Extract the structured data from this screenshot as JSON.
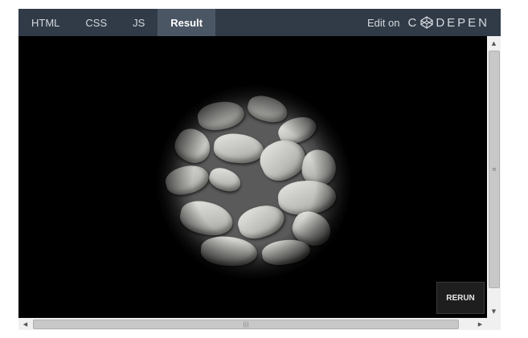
{
  "tabs": [
    {
      "label": "HTML",
      "active": false
    },
    {
      "label": "CSS",
      "active": false
    },
    {
      "label": "JS",
      "active": false
    },
    {
      "label": "Result",
      "active": true
    }
  ],
  "edit_on": {
    "label": "Edit on",
    "brand": "CODEPEN"
  },
  "result": {
    "rerun_label": "RERUN"
  },
  "colors": {
    "topbar_bg": "#313b48",
    "active_tab_bg": "#4b5665",
    "result_bg": "#000000"
  }
}
